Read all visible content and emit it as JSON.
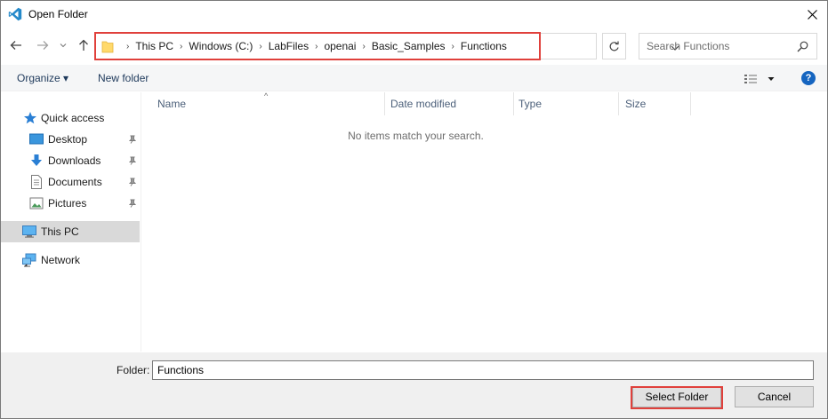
{
  "window": {
    "title": "Open Folder",
    "close_glyph": "✕"
  },
  "navigation": {
    "back_glyph": "←",
    "forward_glyph": "→",
    "recent_glyph": "⌄",
    "up_glyph": "↑",
    "breadcrumbs": [
      "This PC",
      "Windows (C:)",
      "LabFiles",
      "openai",
      "Basic_Samples",
      "Functions"
    ],
    "separator": "›",
    "refresh_glyph": "↻",
    "search_placeholder": "Search Functions"
  },
  "commands": {
    "organize": "Organize ▾",
    "new_folder": "New folder",
    "help": "?"
  },
  "sidebar": {
    "items": [
      {
        "label": "Quick access",
        "icon": "star-icon"
      },
      {
        "label": "Desktop",
        "icon": "desktop-icon",
        "pinned": true
      },
      {
        "label": "Downloads",
        "icon": "download-icon",
        "pinned": true
      },
      {
        "label": "Documents",
        "icon": "document-icon",
        "pinned": true
      },
      {
        "label": "Pictures",
        "icon": "pictures-icon",
        "pinned": true
      },
      {
        "label": "This PC",
        "icon": "computer-icon",
        "selected": true
      },
      {
        "label": "Network",
        "icon": "network-icon"
      }
    ]
  },
  "file_list": {
    "columns": [
      "Name",
      "Date modified",
      "Type",
      "Size"
    ],
    "sort_glyph": "^",
    "empty_message": "No items match your search."
  },
  "footer": {
    "folder_label": "Folder:",
    "folder_value": "Functions",
    "select_button": "Select Folder",
    "cancel_button": "Cancel"
  },
  "colors": {
    "highlight_box": "#e0403b",
    "accent": "#1565c0",
    "vscode_blue": "#2489ca"
  }
}
